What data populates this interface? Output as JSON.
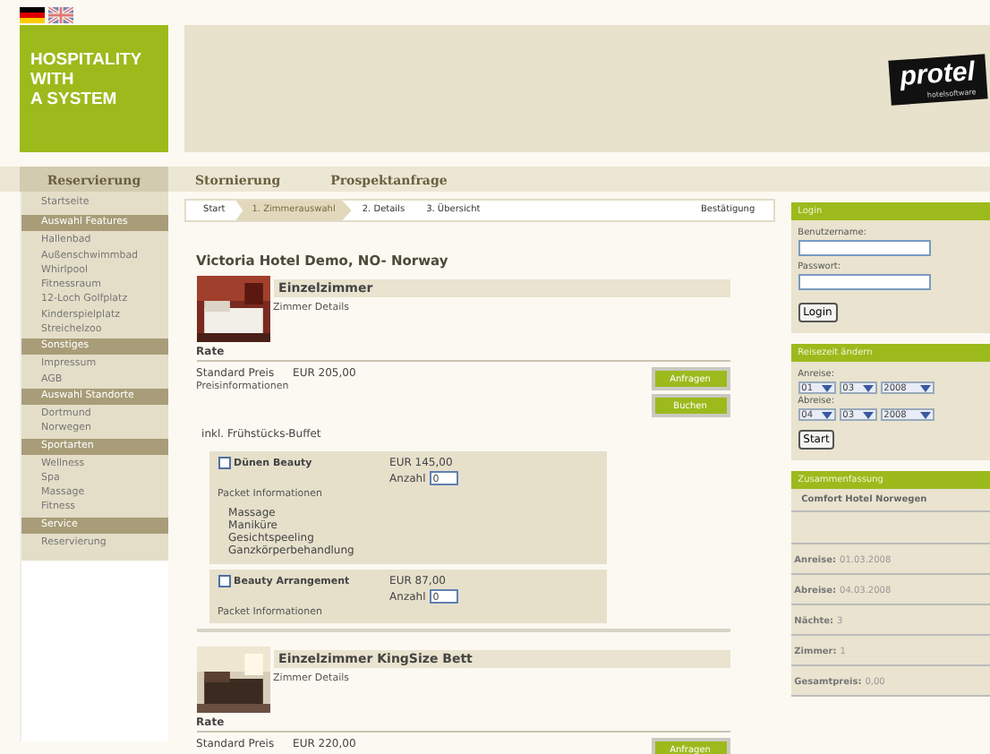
{
  "languages": [
    {
      "kind": "de",
      "selected": true
    },
    {
      "kind": "en",
      "selected": false
    }
  ],
  "logo": {
    "lines": [
      "HOSPITALITY",
      "WITH",
      "A SYSTEM"
    ]
  },
  "brand": {
    "name": "protel",
    "tagline": "hotelsoftware"
  },
  "nav": [
    {
      "label": "Reservierung",
      "selected": true
    },
    {
      "label": "Stornierung",
      "selected": false
    },
    {
      "label": "Prospektanfrage",
      "selected": false
    }
  ],
  "sidebar": {
    "top": "Startseite",
    "sections": [
      {
        "title": "Auswahl Features",
        "items": [
          "Hallenbad",
          "Außenschwimmbad",
          "Whirlpool",
          "Fitnessraum",
          "12-Loch Golfplatz",
          "Kinderspielplatz",
          "Streichelzoo"
        ]
      },
      {
        "title": "Sonstiges",
        "items": [
          "Impressum",
          "AGB"
        ]
      },
      {
        "title": "Auswahl Standorte",
        "items": [
          "Dortmund",
          "Norwegen"
        ]
      },
      {
        "title": "Sportarten",
        "items": [
          "Wellness",
          "Spa",
          "Massage",
          "Fitness"
        ]
      },
      {
        "title": "Service",
        "items": [
          "Reservierung"
        ]
      }
    ]
  },
  "steps": [
    {
      "label": "Start",
      "selected": false
    },
    {
      "label": "1. Zimmerauswahl",
      "selected": true
    },
    {
      "label": "2. Details",
      "selected": false
    },
    {
      "label": "3. Übersicht",
      "selected": false
    },
    {
      "label": "Bestätigung",
      "selected": false
    }
  ],
  "hotel_title": "Victoria Hotel Demo, NO- Norway",
  "rooms": [
    {
      "name": "Einzelzimmer",
      "details_link": "Zimmer Details",
      "rate_label": "Rate",
      "price_label": "Standard Preis",
      "price": "EUR  205,00",
      "price_info": "Preisinformationen",
      "buttons": [
        "Anfragen",
        "Buchen"
      ],
      "note": "inkl. Frühstücks-Buffet",
      "packages": [
        {
          "name": "Dünen Beauty",
          "checked": false,
          "price": "EUR  145,00",
          "qty_label": "Anzahl",
          "qty": "0",
          "info": "Packet Informationen",
          "contents": [
            "Massage",
            "Maniküre",
            "Gesichtspeeling",
            "Ganzkörperbehandlung"
          ]
        },
        {
          "name": "Beauty Arrangement",
          "checked": false,
          "price": "EUR  87,00",
          "qty_label": "Anzahl",
          "qty": "0",
          "info": "Packet Informationen"
        }
      ]
    },
    {
      "name": "Einzelzimmer KingSize Bett",
      "details_link": "Zimmer Details",
      "rate_label": "Rate",
      "price_label": "Standard Preis",
      "price": "EUR  220,00",
      "buttons": [
        "Anfragen"
      ]
    }
  ],
  "login": {
    "title": "Login",
    "user_label": "Benutzername:",
    "password_label": "Passwort:",
    "button": "Login"
  },
  "travel": {
    "title": "Reisezeit ändern",
    "arrival_label": "Anreise:",
    "arrival": [
      "01",
      "03",
      "2008"
    ],
    "departure_label": "Abreise:",
    "departure": [
      "04",
      "03",
      "2008"
    ],
    "button": "Start"
  },
  "summary": {
    "title": "Zusammenfassung",
    "hotel": "Comfort Hotel Norwegen",
    "rows": [
      {
        "label": "Anreise:",
        "value": "01.03.2008"
      },
      {
        "label": "Abreise:",
        "value": "04.03.2008"
      },
      {
        "label": "Nächte:",
        "value": "3"
      },
      {
        "label": "Zimmer:",
        "value": "1"
      },
      {
        "label": "Gesamtpreis:",
        "value": "0,00"
      }
    ]
  }
}
